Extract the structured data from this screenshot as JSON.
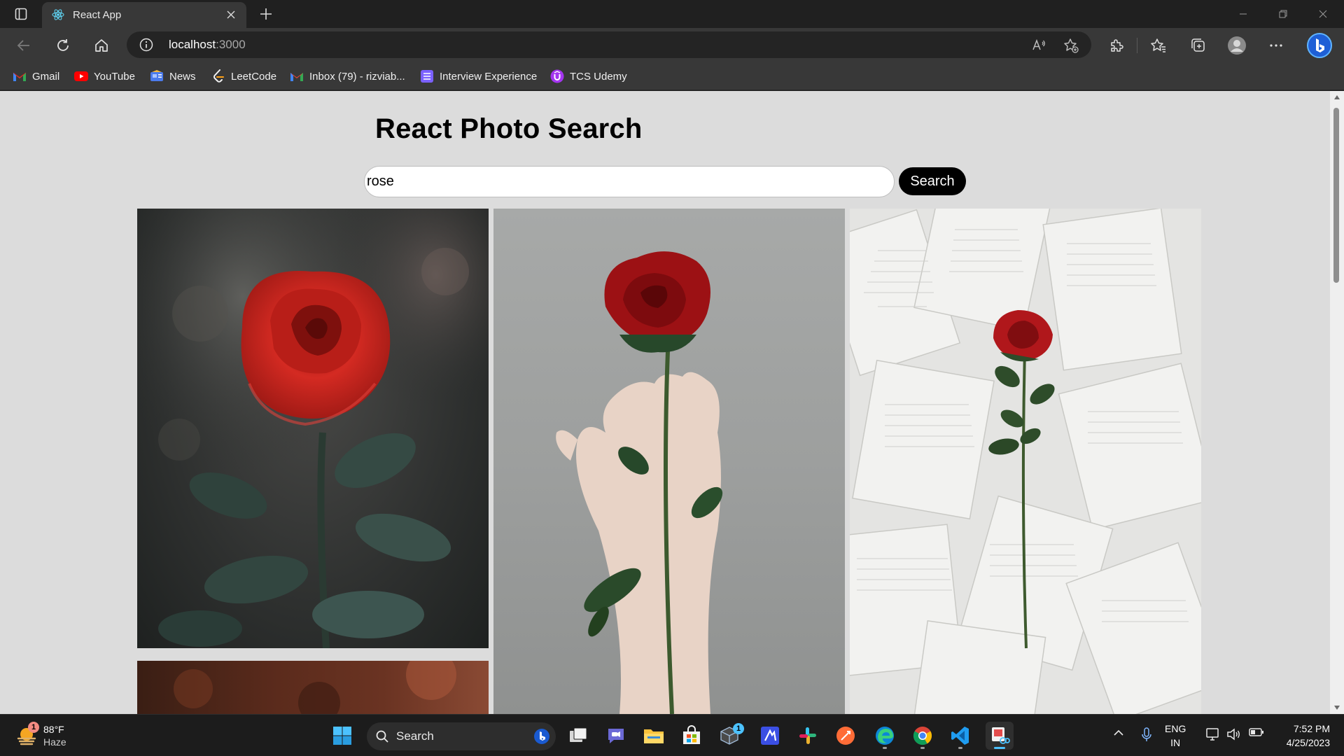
{
  "browser": {
    "tab_title": "React App",
    "url_host": "localhost",
    "url_port": ":3000"
  },
  "bookmarks": [
    {
      "label": "Gmail",
      "icon": "gmail-icon"
    },
    {
      "label": "YouTube",
      "icon": "youtube-icon"
    },
    {
      "label": "News",
      "icon": "news-icon"
    },
    {
      "label": "LeetCode",
      "icon": "leetcode-icon"
    },
    {
      "label": "Inbox (79) - rizviab...",
      "icon": "gmail-icon"
    },
    {
      "label": "Interview Experience",
      "icon": "list-icon"
    },
    {
      "label": "TCS Udemy",
      "icon": "udemy-icon"
    }
  ],
  "page": {
    "title": "React Photo Search",
    "search_value": "rose",
    "search_button": "Search",
    "photos": [
      {
        "subject": "red-rose-dew"
      },
      {
        "subject": "hand-holding-rose"
      },
      {
        "subject": "rose-on-book-pages"
      },
      {
        "subject": "rose-partial"
      }
    ]
  },
  "taskbar": {
    "weather_temp": "88°F",
    "weather_cond": "Haze",
    "weather_badge": "1",
    "search_label": "Search",
    "store_badge": "1",
    "lang_line1": "ENG",
    "lang_line2": "IN",
    "time": "7:52 PM",
    "date": "4/25/2023"
  },
  "colors": {
    "page_bg": "#dcdcdc",
    "chrome_bg": "#383838",
    "accent": "#4cc2ff"
  }
}
